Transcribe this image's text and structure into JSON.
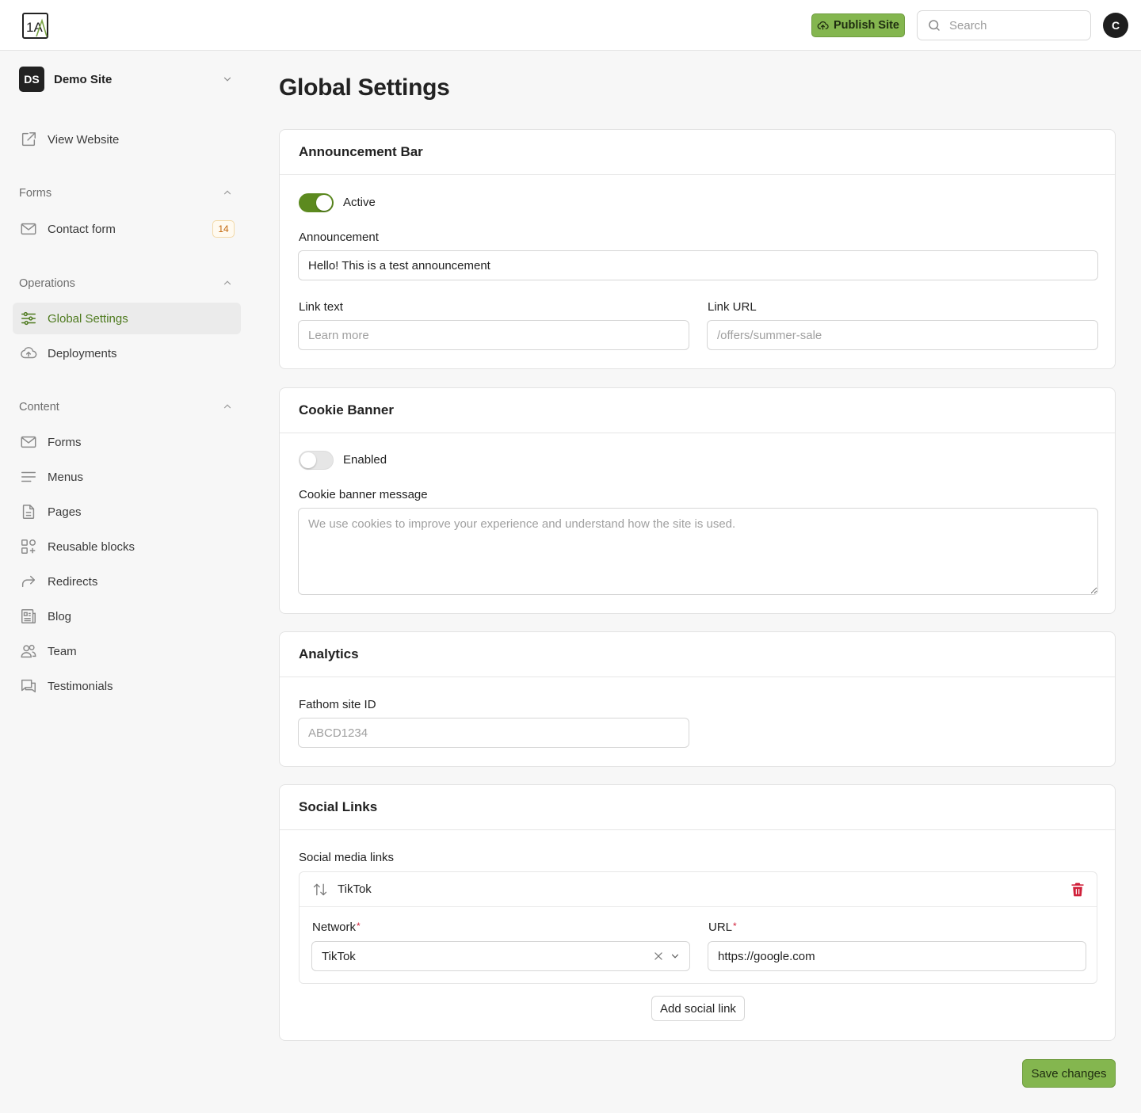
{
  "topbar": {
    "logo_text": "1A",
    "publish_label": "Publish Site",
    "search_placeholder": "Search",
    "user_initial": "C"
  },
  "sidebar": {
    "site": {
      "initials": "DS",
      "name": "Demo Site"
    },
    "view_website": "View Website",
    "sections": {
      "forms": {
        "label": "Forms",
        "items": [
          {
            "label": "Contact form",
            "count": "14"
          }
        ]
      },
      "operations": {
        "label": "Operations",
        "items": [
          {
            "label": "Global Settings",
            "active": true
          },
          {
            "label": "Deployments"
          }
        ]
      },
      "content": {
        "label": "Content",
        "items": [
          {
            "label": "Forms"
          },
          {
            "label": "Menus"
          },
          {
            "label": "Pages"
          },
          {
            "label": "Reusable blocks"
          },
          {
            "label": "Redirects"
          },
          {
            "label": "Blog"
          },
          {
            "label": "Team"
          },
          {
            "label": "Testimonials"
          }
        ]
      }
    }
  },
  "main": {
    "title": "Global Settings",
    "announcement": {
      "heading": "Announcement Bar",
      "toggle_label": "Active",
      "toggle_on": true,
      "announcement_label": "Announcement",
      "announcement_value": "Hello! This is a test announcement",
      "link_text_label": "Link text",
      "link_text_placeholder": "Learn more",
      "link_url_label": "Link URL",
      "link_url_placeholder": "/offers/summer-sale"
    },
    "cookie": {
      "heading": "Cookie Banner",
      "toggle_label": "Enabled",
      "toggle_on": false,
      "message_label": "Cookie banner message",
      "message_placeholder": "We use cookies to improve your experience and understand how the site is used."
    },
    "analytics": {
      "heading": "Analytics",
      "fathom_label": "Fathom site ID",
      "fathom_placeholder": "ABCD1234"
    },
    "social": {
      "heading": "Social Links",
      "list_label": "Social media links",
      "items": [
        {
          "title": "TikTok",
          "network_label": "Network",
          "network_value": "TikTok",
          "url_label": "URL",
          "url_value": "https://google.com"
        }
      ],
      "add_label": "Add social link"
    },
    "save_label": "Save changes"
  },
  "colors": {
    "accent": "#84b64f",
    "active_text": "#4e7a1e",
    "toggle_on": "#5c8a1f",
    "danger": "#d0203a",
    "badge": "#c2670c"
  }
}
